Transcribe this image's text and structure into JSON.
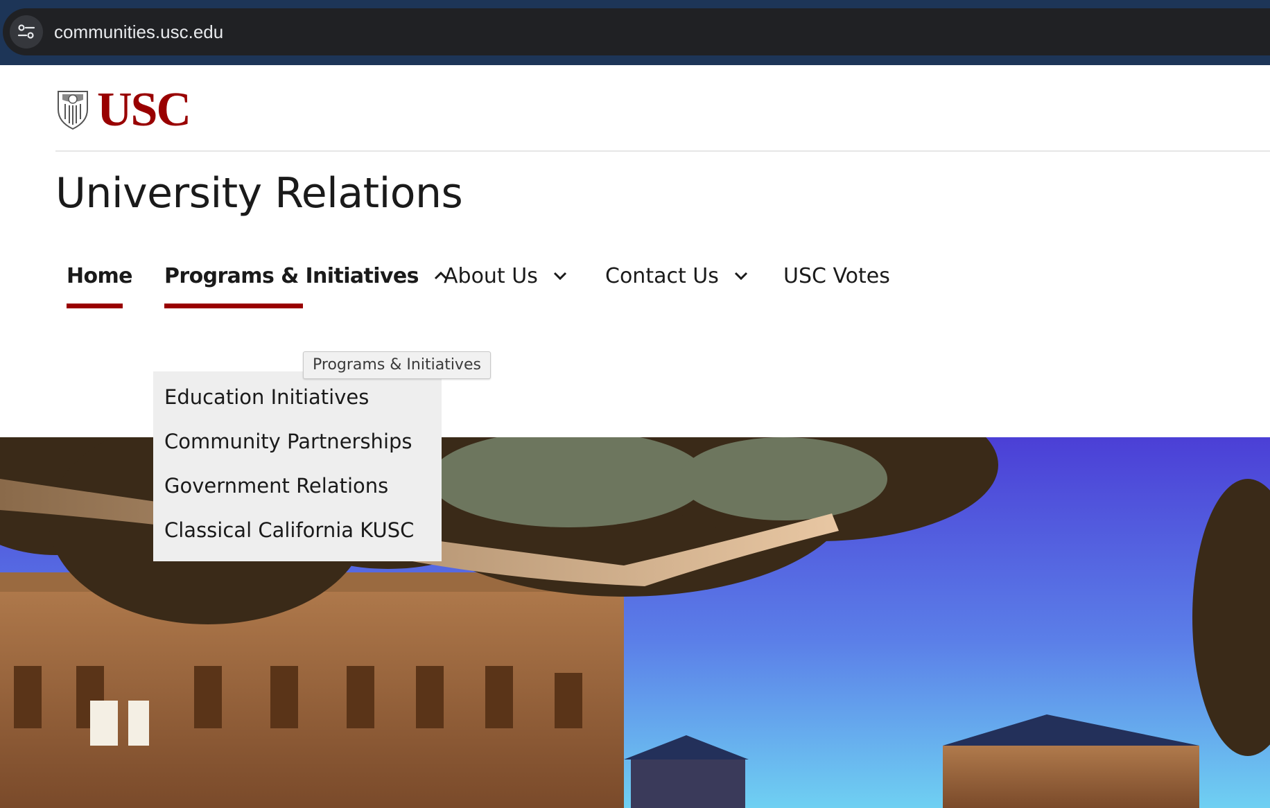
{
  "browser": {
    "url": "communities.usc.edu",
    "site_info_icon": "tune-icon"
  },
  "header": {
    "logo_text": "USC",
    "logo_icon": "usc-seal-icon",
    "site_title": "University Relations"
  },
  "nav": {
    "items": [
      {
        "label": "Home",
        "active": true
      },
      {
        "label": "Programs & Initiatives",
        "active": true,
        "expanded": true
      },
      {
        "label": "About Us",
        "expanded": false
      },
      {
        "label": "Contact Us",
        "expanded": false
      },
      {
        "label": "USC Votes"
      }
    ],
    "tooltip": "Programs & Initiatives",
    "dropdown": [
      {
        "label": "Education Initiatives"
      },
      {
        "label": "Community Partnerships"
      },
      {
        "label": "Government Relations"
      },
      {
        "label": "Classical California KUSC"
      }
    ]
  },
  "colors": {
    "brand": "#990000",
    "chrome": "#202124",
    "dropdown_bg": "#eeeeee"
  }
}
